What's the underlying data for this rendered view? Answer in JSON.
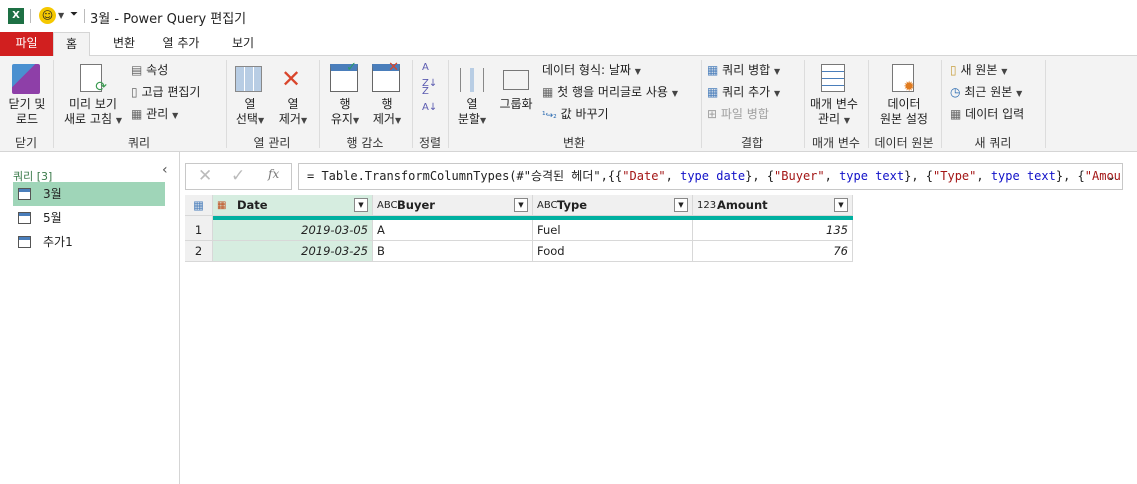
{
  "titlebar": {
    "title": "3월 - Power Query 편집기",
    "app_icon": "excel-icon",
    "smiley": "smiley-icon"
  },
  "tabs": [
    {
      "label": "파일"
    },
    {
      "label": "홈"
    },
    {
      "label": "변환"
    },
    {
      "label": "열 추가"
    },
    {
      "label": "보기"
    }
  ],
  "ribbon": {
    "close": {
      "btn": [
        "닫기 및",
        "로드"
      ],
      "group": "닫기"
    },
    "query": {
      "refresh": [
        "미리 보기",
        "새로 고침"
      ],
      "properties": "속성",
      "advanced": "고급 편집기",
      "manage": "관리",
      "group": "쿼리"
    },
    "colmgmt": {
      "choose": [
        "열",
        "선택"
      ],
      "remove": [
        "열",
        "제거"
      ],
      "group": "열 관리"
    },
    "rowred": {
      "keep": [
        "행",
        "유지"
      ],
      "remove": [
        "행",
        "제거"
      ],
      "group": "행 감소"
    },
    "sort": {
      "group": "정렬"
    },
    "transform": {
      "split": [
        "열",
        "분할"
      ],
      "groupby": "그룹화",
      "datatype": "데이터 형식: 날짜",
      "firstrow": "첫 행을 머리글로 사용",
      "replace": "값 바꾸기",
      "group": "변환"
    },
    "combine": {
      "merge": "쿼리 병합",
      "append": "쿼리 추가",
      "files": "파일 병합",
      "group": "결합"
    },
    "params": {
      "manage": [
        "매개 변수",
        "관리"
      ],
      "group": "매개 변수"
    },
    "datasource": {
      "settings": [
        "데이터",
        "원본 설정"
      ],
      "group": "데이터 원본"
    },
    "newquery": {
      "newsource": "새 원본",
      "recent": "최근 원본",
      "enter": "데이터 입력",
      "group": "새 쿼리"
    }
  },
  "queries": {
    "header": "쿼리 [3]",
    "items": [
      {
        "label": "3월",
        "selected": true
      },
      {
        "label": "5월"
      },
      {
        "label": "추가1"
      }
    ]
  },
  "formula": {
    "prefix": "= Table.TransformColumnTypes(#\"승격된 헤더\",{{",
    "p1": "\"Date\"",
    "p2": ", ",
    "k1": "type date",
    "p3": "}, {",
    "p4": "\"Buyer\"",
    "p5": ", ",
    "k2": "type text",
    "p6": "}, {",
    "p7": "\"Type\"",
    "p8": ", ",
    "k3": "type text",
    "p9": "}, {",
    "p10": "\"Amount\"",
    "p11": ","
  },
  "table": {
    "columns": [
      {
        "name": "Date",
        "type": "date"
      },
      {
        "name": "Buyer",
        "type": "ABC"
      },
      {
        "name": "Type",
        "type": "ABC"
      },
      {
        "name": "Amount",
        "type": "123"
      }
    ],
    "rows": [
      [
        "1",
        "2019-03-05",
        "A",
        "Fuel",
        "135"
      ],
      [
        "2",
        "2019-03-25",
        "B",
        "Food",
        "76"
      ]
    ],
    "accent": "#00b0a0"
  }
}
